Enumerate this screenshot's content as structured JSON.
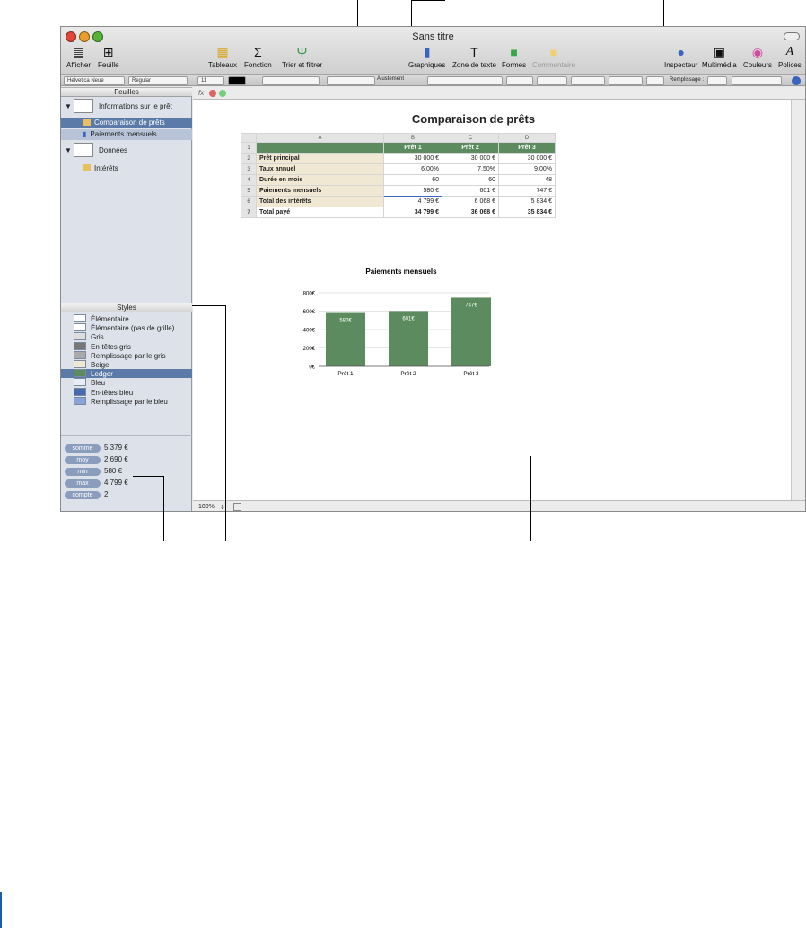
{
  "window": {
    "title": "Sans titre"
  },
  "toolbar": {
    "afficher": "Afficher",
    "feuille": "Feuille",
    "tableaux": "Tableaux",
    "fonction": "Fonction",
    "trier": "Trier et filtrer",
    "graphiques": "Graphiques",
    "zone_texte": "Zone de texte",
    "formes": "Formes",
    "commentaire": "Commentaire",
    "inspecteur": "Inspecteur",
    "multimedia": "Multimédia",
    "couleurs": "Couleurs",
    "polices": "Polices"
  },
  "format_bar": {
    "font": "Helvetica Neue",
    "style": "Regular",
    "size": "11",
    "ajustement": "Ajustement",
    "remplissage": "Remplissage :"
  },
  "sidebar": {
    "sheets_header": "Feuilles",
    "sheet1": "Informations sur le prêt",
    "sheet1_item1": "Comparaison de prêts",
    "sheet1_item2": "Paiements mensuels",
    "sheet2": "Données",
    "sheet2_item1": "Intérêts",
    "styles_header": "Styles",
    "styles": [
      "Élémentaire",
      "Élémentaire (pas de grille)",
      "Gris",
      "En-têtes gris",
      "Remplissage par le gris",
      "Beige",
      "Ledger",
      "Bleu",
      "En-têtes bleu",
      "Remplissage par le bleu"
    ],
    "stats": [
      {
        "k": "somme",
        "v": "5 379 €"
      },
      {
        "k": "moy",
        "v": "2 690 €"
      },
      {
        "k": "min",
        "v": "580 €"
      },
      {
        "k": "max",
        "v": "4 799 €"
      },
      {
        "k": "compte",
        "v": "2"
      }
    ]
  },
  "table": {
    "title": "Comparaison de prêts",
    "cols": [
      "A",
      "B",
      "C",
      "D"
    ],
    "header": [
      "",
      "Prêt 1",
      "Prêt 2",
      "Prêt 3"
    ],
    "rows": [
      [
        "Prêt principal",
        "30 000 €",
        "30 000 €",
        "30 000 €"
      ],
      [
        "Taux annuel",
        "6,00%",
        "7,50%",
        "9,00%"
      ],
      [
        "Durée en mois",
        "60",
        "60",
        "48"
      ],
      [
        "Paiements mensuels",
        "580 €",
        "601 €",
        "747 €"
      ],
      [
        "Total des intérêts",
        "4 799 €",
        "6 068 €",
        "5 834 €"
      ],
      [
        "Total payé",
        "34 799 €",
        "36 068 €",
        "35 834 €"
      ]
    ]
  },
  "zoom": "100%",
  "chart_data": {
    "type": "bar",
    "title": "Paiements mensuels",
    "categories": [
      "Prêt 1",
      "Prêt 2",
      "Prêt 3"
    ],
    "values": [
      580,
      601,
      747
    ],
    "value_labels": [
      "580€",
      "601€",
      "747€"
    ],
    "ylim": [
      0,
      800
    ],
    "yticks": [
      "0€",
      "200€",
      "400€",
      "600€",
      "800€"
    ],
    "grid": true,
    "color": "#5b8b5f"
  }
}
